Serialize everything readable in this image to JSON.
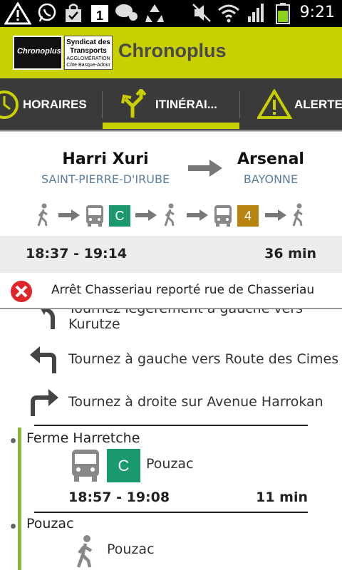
{
  "status_bar": {
    "time": "9:21"
  },
  "header": {
    "logo_left": "Chronoplus",
    "logo_right_lines": [
      "Syndicat des",
      "Transports",
      "AGGLOMÉRATION",
      "Côte Basque-Adour"
    ],
    "title": "Chronoplus"
  },
  "tabs": [
    {
      "label": "HORAIRES",
      "icon": "clock-icon"
    },
    {
      "label": "ITINÉRAI...",
      "icon": "split-arrows-icon",
      "selected": true
    },
    {
      "label": "ALERTES",
      "icon": "warning-icon"
    }
  ],
  "route": {
    "from_name": "Harri Xuri",
    "from_city": "SAINT-PIERRE-D'IRUBE",
    "to_name": "Arsenal",
    "to_city": "BAYONNE",
    "legs": [
      {
        "kind": "walk"
      },
      {
        "kind": "bus",
        "line": "C",
        "color": "#1a9a6c"
      },
      {
        "kind": "walk"
      },
      {
        "kind": "bus",
        "line": "4",
        "color": "#b9830f"
      },
      {
        "kind": "walk"
      }
    ]
  },
  "summary": {
    "times": "18:37 - 19:14",
    "duration": "36 min"
  },
  "alert": {
    "text": "Arrêt  Chasseriau  reporté rue de Chasseriau"
  },
  "steps": [
    {
      "text": "Tournez légèrement à gauche vers",
      "text2": "Kurutze",
      "icon": "turn-slight-left-icon"
    },
    {
      "text": "Tournez à gauche vers Route des Cimes",
      "icon": "turn-left-icon"
    },
    {
      "text": "Tournez à droite sur Avenue Harrokan",
      "icon": "turn-right-icon"
    }
  ],
  "stop1": {
    "name": "Ferme Harretche",
    "line": "C",
    "line_color": "#1a9a6c",
    "destination": "Pouzac",
    "times": "18:57 - 19:08",
    "duration": "11 min"
  },
  "stop2": {
    "name": "Pouzac",
    "destination": "Pouzac"
  }
}
